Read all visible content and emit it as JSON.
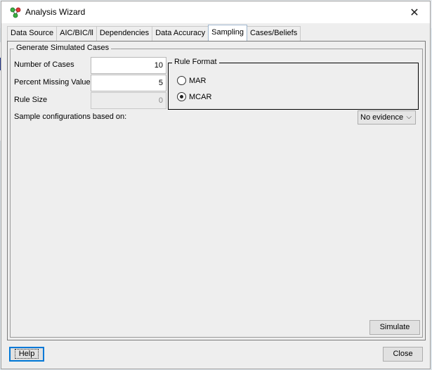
{
  "window": {
    "title": "Analysis Wizard"
  },
  "tabs": [
    {
      "label": "Data Source"
    },
    {
      "label": "AIC/BIC/ll"
    },
    {
      "label": "Dependencies"
    },
    {
      "label": "Data Accuracy"
    },
    {
      "label": "Sampling",
      "active": true
    },
    {
      "label": "Cases/Beliefs"
    }
  ],
  "group": {
    "title": "Generate Simulated Cases",
    "number_of_cases": {
      "label": "Number of Cases",
      "value": "10"
    },
    "percent_missing": {
      "label": "Percent Missing Values",
      "value": "5"
    },
    "rule_size": {
      "label": "Rule Size",
      "value": "0"
    },
    "rule_format": {
      "title": "Rule Format",
      "options": [
        {
          "label": "MAR",
          "checked": false
        },
        {
          "label": "MCAR",
          "checked": true
        }
      ]
    },
    "sample_config": {
      "label": "Sample configurations based on:",
      "selected": "No evidence"
    },
    "simulate_label": "Simulate"
  },
  "footer": {
    "help_label": "Help",
    "close_label": "Close"
  },
  "icons": {
    "app": "network-nodes-icon",
    "close": "close-icon",
    "dropdown": "chevron-down-icon"
  },
  "colors": {
    "focus": "#0078d7",
    "active_tab": "#ffffff"
  }
}
